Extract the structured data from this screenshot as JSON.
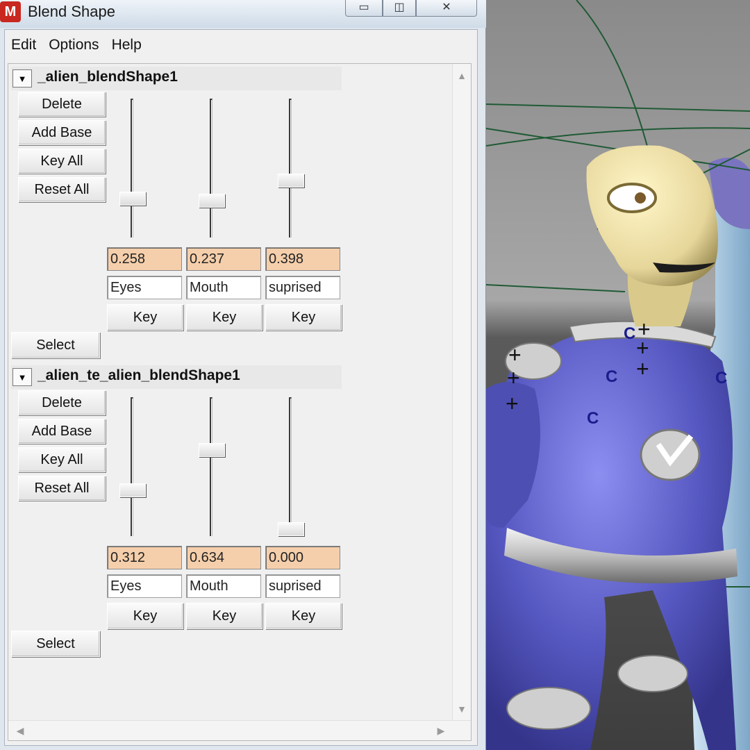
{
  "window": {
    "title": "Blend Shape",
    "app_icon": "maya-app-icon",
    "controls": {
      "minimize": "▭",
      "maximize": "◫",
      "close": "✕"
    }
  },
  "menu": [
    "Edit",
    "Options",
    "Help"
  ],
  "groups": [
    {
      "title": "_alien_blendShape1",
      "collapse_glyph": "▼",
      "buttons": {
        "delete": "Delete",
        "add_base": "Add Base",
        "key_all": "Key All",
        "reset_all": "Reset All"
      },
      "targets": [
        {
          "name": "Eyes",
          "value": "0.258",
          "weight": 0.258,
          "key_label": "Key"
        },
        {
          "name": "Mouth",
          "value": "0.237",
          "weight": 0.237,
          "key_label": "Key"
        },
        {
          "name": "suprised",
          "value": "0.398",
          "weight": 0.398,
          "key_label": "Key"
        }
      ],
      "select_label": "Select"
    },
    {
      "title": "_alien_te_alien_blendShape1",
      "collapse_glyph": "▼",
      "buttons": {
        "delete": "Delete",
        "add_base": "Add Base",
        "key_all": "Key All",
        "reset_all": "Reset All"
      },
      "targets": [
        {
          "name": "Eyes",
          "value": "0.312",
          "weight": 0.312,
          "key_label": "Key"
        },
        {
          "name": "Mouth",
          "value": "0.634",
          "weight": 0.634,
          "key_label": "Key"
        },
        {
          "name": "suprised",
          "value": "0.000",
          "weight": 0.0,
          "key_label": "Key"
        }
      ],
      "select_label": "Select"
    }
  ],
  "scrollbars": {
    "up": "▲",
    "down": "▼",
    "left": "◀",
    "right": "▶"
  },
  "viewport": {
    "control_letters": [
      "C",
      "C",
      "C",
      "C"
    ],
    "cross_marks": [
      "+",
      "+",
      "+",
      "+",
      "+",
      "+"
    ],
    "colors": {
      "suit": "#5d5fc2",
      "head": "#ecdfa6",
      "controls": "#1b1c8c",
      "curves": "#1f5a34"
    }
  }
}
